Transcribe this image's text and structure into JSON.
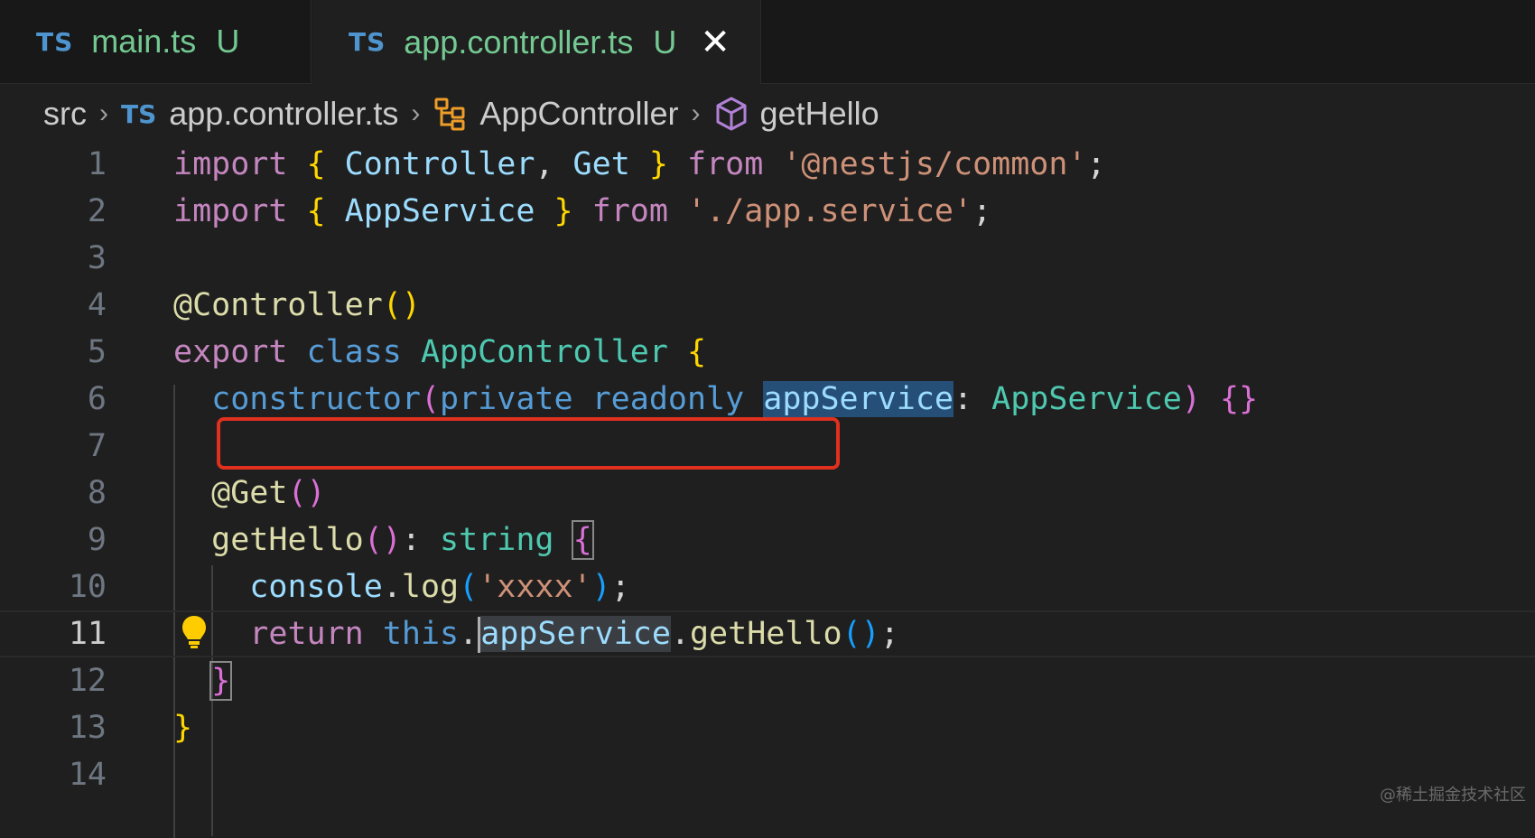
{
  "tabs": [
    {
      "icon": "TS",
      "label": "main.ts",
      "status": "U"
    },
    {
      "icon": "TS",
      "label": "app.controller.ts",
      "status": "U",
      "close": "✕"
    }
  ],
  "breadcrumb": {
    "folder": "src",
    "file_icon": "TS",
    "file": "app.controller.ts",
    "class": "AppController",
    "method": "getHello"
  },
  "editor": {
    "line_numbers": [
      "1",
      "2",
      "3",
      "4",
      "5",
      "6",
      "7",
      "8",
      "9",
      "10",
      "11",
      "12",
      "13",
      "14"
    ],
    "active_line": "11",
    "lines": [
      [
        [
          "kw",
          "import "
        ],
        [
          "br1",
          "{ "
        ],
        [
          "var",
          "Controller"
        ],
        [
          "plain",
          ", "
        ],
        [
          "var",
          "Get"
        ],
        [
          "br1",
          " }"
        ],
        [
          "kw",
          " from "
        ],
        [
          "str",
          "'@nestjs/common'"
        ],
        [
          "plain",
          ";"
        ]
      ],
      [
        [
          "kw",
          "import "
        ],
        [
          "br1",
          "{ "
        ],
        [
          "var",
          "AppService"
        ],
        [
          "br1",
          " }"
        ],
        [
          "kw",
          " from "
        ],
        [
          "str",
          "'./app.service'"
        ],
        [
          "plain",
          ";"
        ]
      ],
      [],
      [
        [
          "fn",
          "@Controller"
        ],
        [
          "br1",
          "()"
        ]
      ],
      [
        [
          "kw",
          "export "
        ],
        [
          "kwb",
          "class "
        ],
        [
          "cls",
          "AppController "
        ],
        [
          "br1",
          "{"
        ]
      ],
      [
        [
          "plain",
          "  "
        ],
        [
          "kwb",
          "constructor"
        ],
        [
          "br2",
          "("
        ],
        [
          "kwb",
          "private "
        ],
        [
          "kwb",
          "readonly "
        ],
        [
          "hl var",
          "appService"
        ],
        [
          "plain",
          ": "
        ],
        [
          "cls",
          "AppService"
        ],
        [
          "br2",
          ")"
        ],
        [
          "plain",
          " "
        ],
        [
          "br2",
          "{}"
        ]
      ],
      [],
      [
        [
          "plain",
          "  "
        ],
        [
          "fn",
          "@Get"
        ],
        [
          "br2",
          "()"
        ]
      ],
      [
        [
          "plain",
          "  "
        ],
        [
          "fn",
          "getHello"
        ],
        [
          "br2",
          "()"
        ],
        [
          "plain",
          ": "
        ],
        [
          "cls",
          "string "
        ],
        [
          "br2 box-bracket",
          "{"
        ]
      ],
      [
        [
          "plain",
          "    "
        ],
        [
          "var",
          "console"
        ],
        [
          "plain",
          "."
        ],
        [
          "fn",
          "log"
        ],
        [
          "br3",
          "("
        ],
        [
          "str",
          "'xxxx'"
        ],
        [
          "br3",
          ")"
        ],
        [
          "plain",
          ";"
        ]
      ],
      [
        [
          "plain",
          "    "
        ],
        [
          "kw",
          "return "
        ],
        [
          "kwb",
          "this"
        ],
        [
          "plain",
          "."
        ],
        [
          "cursor",
          ""
        ],
        [
          "hl2 var",
          "appService"
        ],
        [
          "plain",
          "."
        ],
        [
          "fn",
          "getHello"
        ],
        [
          "br3",
          "()"
        ],
        [
          "plain",
          ";"
        ]
      ],
      [
        [
          "plain",
          "  "
        ],
        [
          "br2 box-bracket",
          "}"
        ]
      ],
      [
        [
          "br1",
          "}"
        ]
      ],
      []
    ]
  },
  "watermark": "@稀土掘金技术社区"
}
